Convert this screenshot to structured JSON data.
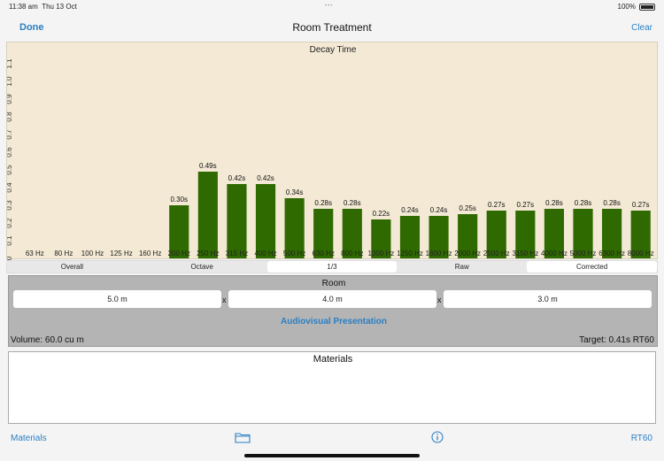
{
  "status_bar": {
    "time": "11:38 am",
    "date": "Thu 13 Oct",
    "battery": "100%"
  },
  "nav": {
    "done": "Done",
    "title": "Room Treatment",
    "clear": "Clear"
  },
  "chart_data": {
    "type": "bar",
    "title": "Decay Time",
    "categories": [
      "63 Hz",
      "80 Hz",
      "100 Hz",
      "125 Hz",
      "160 Hz",
      "200 Hz",
      "250 Hz",
      "315 Hz",
      "400 Hz",
      "500 Hz",
      "630 Hz",
      "800 Hz",
      "1000 Hz",
      "1250 Hz",
      "1600 Hz",
      "2000 Hz",
      "2500 Hz",
      "3150 Hz",
      "4000 Hz",
      "5000 Hz",
      "6300 Hz",
      "8000 Hz"
    ],
    "values": [
      null,
      null,
      null,
      null,
      null,
      0.3,
      0.49,
      0.42,
      0.42,
      0.34,
      0.28,
      0.28,
      0.22,
      0.24,
      0.24,
      0.25,
      0.27,
      0.27,
      0.28,
      0.28,
      0.28,
      0.27
    ],
    "value_labels": [
      "",
      "",
      "",
      "",
      "",
      "0.30s",
      "0.49s",
      "0.42s",
      "0.42s",
      "0.34s",
      "0.28s",
      "0.28s",
      "0.22s",
      "0.24s",
      "0.24s",
      "0.25s",
      "0.27s",
      "0.27s",
      "0.28s",
      "0.28s",
      "0.28s",
      "0.27s"
    ],
    "yticks": [
      "0",
      "0.1",
      "0.2",
      "0.3",
      "0.4",
      "0.5",
      "0.6",
      "0.7",
      "0.8",
      "0.9",
      "1.0",
      "1.1"
    ],
    "ylim": [
      0,
      1.15
    ],
    "bar_color": "#2f6a00",
    "background": "#f3e9d4"
  },
  "segments": [
    "Overall",
    "Octave",
    "1/3",
    "Raw",
    "Corrected"
  ],
  "room": {
    "title": "Room",
    "width": "5.0 m",
    "length": "4.0 m",
    "height": "3.0 m",
    "separator": "x",
    "preset": "Audiovisual Presentation",
    "volume": "Volume: 60.0 cu m",
    "target": "Target: 0.41s RT60"
  },
  "materials": {
    "title": "Materials"
  },
  "toolbar": {
    "materials": "Materials",
    "rt60": "RT60",
    "folder_icon": "folder-icon",
    "info_icon": "info-icon"
  }
}
